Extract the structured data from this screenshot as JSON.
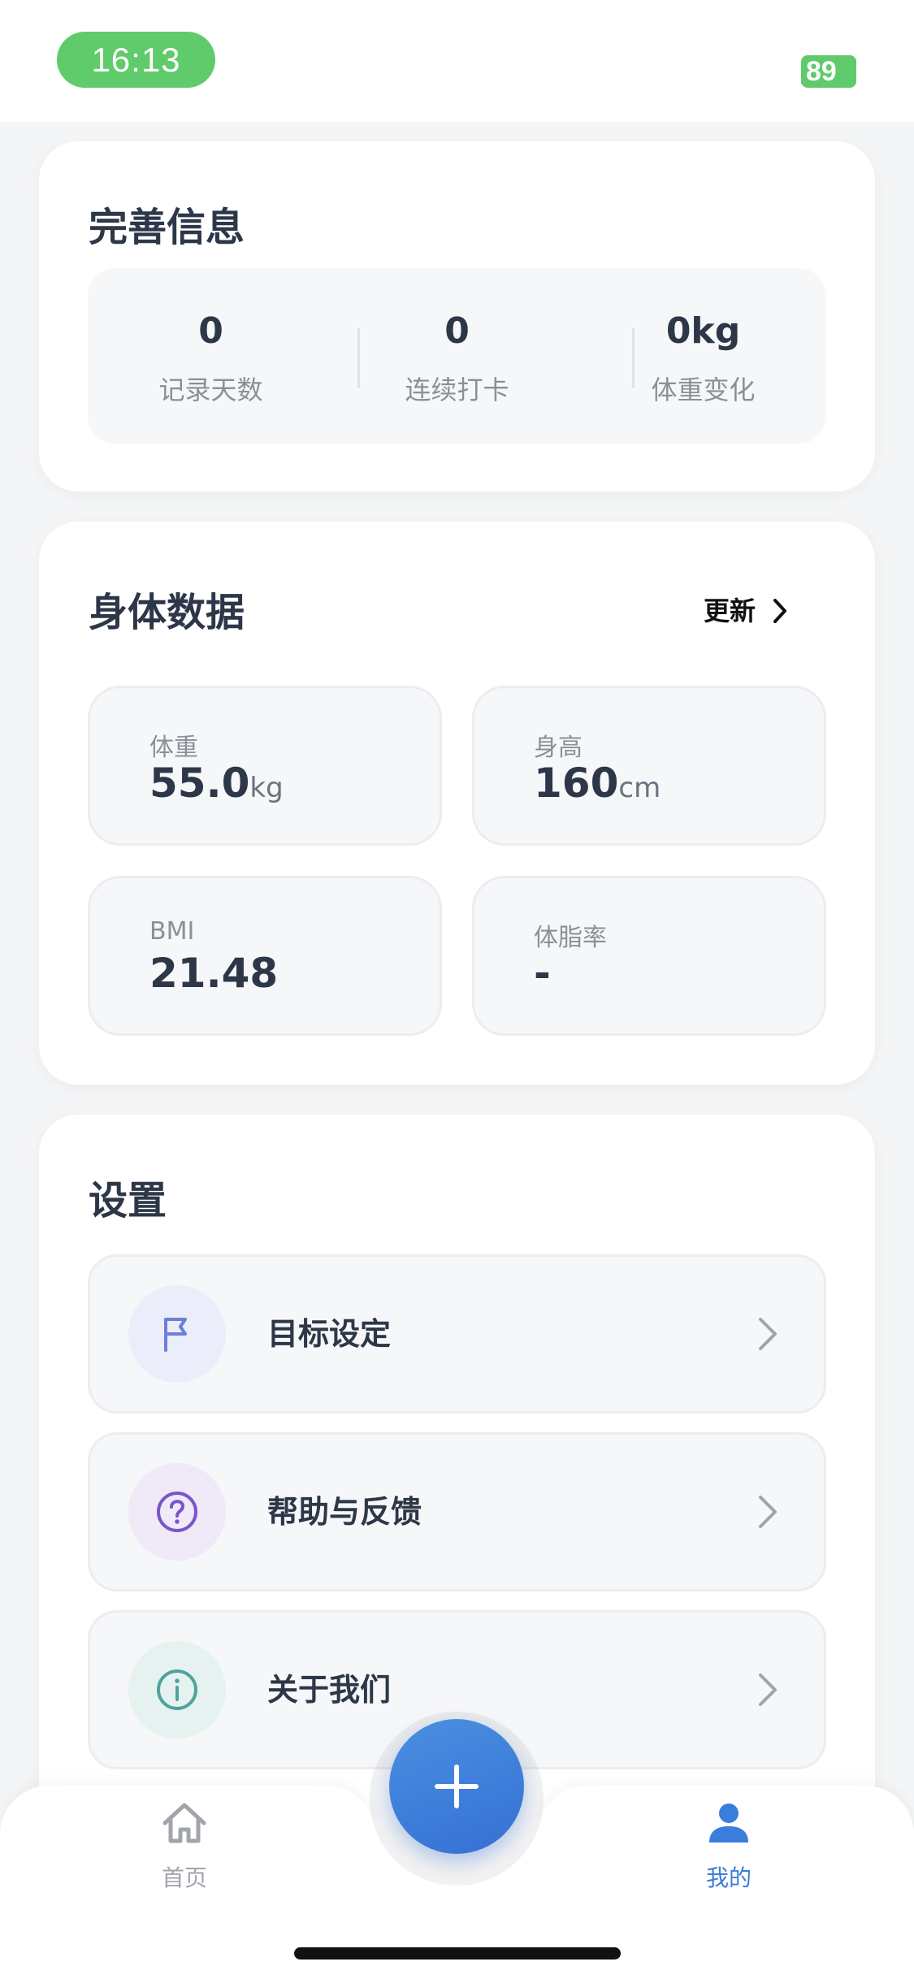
{
  "status_bar": {
    "time": "16:13",
    "battery": "89"
  },
  "profile_card": {
    "title": "完善信息",
    "stats": [
      {
        "value": "0",
        "label": "记录天数"
      },
      {
        "value": "0",
        "label": "连续打卡"
      },
      {
        "value": "0kg",
        "label": "体重变化"
      }
    ]
  },
  "body_data": {
    "title": "身体数据",
    "update_label": "更新",
    "metrics": [
      {
        "label": "体重",
        "value": "55.0",
        "unit": "kg"
      },
      {
        "label": "身高",
        "value": "160",
        "unit": "cm"
      },
      {
        "label": "BMI",
        "value": "21.48",
        "unit": ""
      },
      {
        "label": "体脂率",
        "value": "-",
        "unit": ""
      }
    ]
  },
  "settings": {
    "title": "设置",
    "items": [
      {
        "label": "目标设定",
        "icon": "flag-icon",
        "icon_color": "#6c7fd8",
        "icon_bg": "#ebedfa"
      },
      {
        "label": "帮助与反馈",
        "icon": "question-icon",
        "icon_color": "#7a55c9",
        "icon_bg": "#efe9f8"
      },
      {
        "label": "关于我们",
        "icon": "info-icon",
        "icon_color": "#4fa39b",
        "icon_bg": "#e6f2f0"
      }
    ]
  },
  "tabbar": {
    "tabs": [
      {
        "label": "首页",
        "icon": "home-icon",
        "active": false
      },
      {
        "label": "我的",
        "icon": "user-icon",
        "active": true
      }
    ],
    "fab_icon": "plus-icon"
  },
  "colors": {
    "accent": "#3b7ddd",
    "inactive": "#a0a4ab",
    "text": "#2d3748",
    "status_green": "#5fcb6b"
  }
}
